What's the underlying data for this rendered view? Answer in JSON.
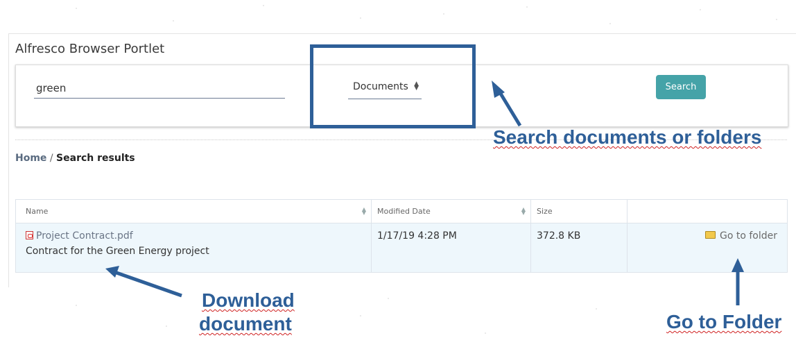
{
  "portlet": {
    "title": "Alfresco Browser Portlet"
  },
  "search": {
    "query_value": "green",
    "type_selected": "Documents",
    "button_label": "Search"
  },
  "breadcrumb": {
    "home": "Home",
    "separator": "/",
    "current": "Search results"
  },
  "table": {
    "columns": [
      "Name",
      "Modified Date",
      "Size",
      ""
    ],
    "rows": [
      {
        "file_name": "Project Contract.pdf",
        "description": "Contract for the Green Energy project",
        "modified": "1/17/19 4:28 PM",
        "size": "372.8 KB",
        "action": "Go to folder"
      }
    ]
  },
  "annotations": {
    "search_note": "Search documents or folders",
    "download_line1": "Download",
    "download_line2": "document",
    "folder_note": "Go to Folder"
  },
  "colors": {
    "accent": "#45a3a8",
    "annotation": "#2e5f98",
    "row_highlight": "#eef7fc"
  }
}
